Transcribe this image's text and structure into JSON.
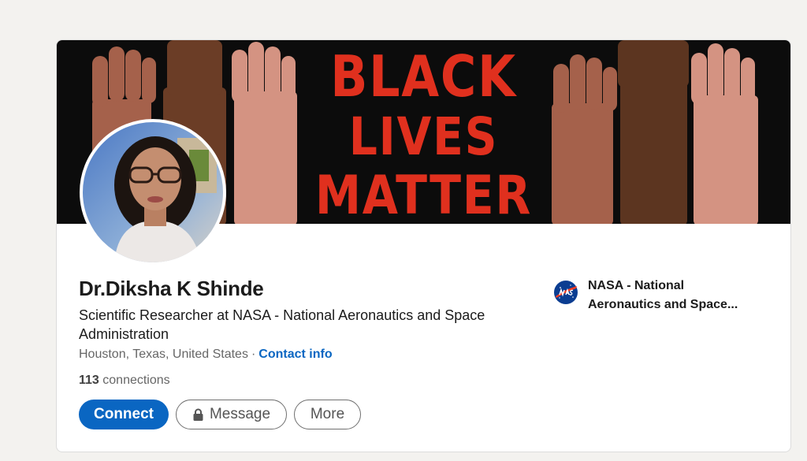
{
  "banner": {
    "line1": "BLACK",
    "line2": "LIVES",
    "line3": "MATTER"
  },
  "profile": {
    "name": "Dr.Diksha K Shinde",
    "headline": "Scientific Researcher at NASA - National Aeronautics and Space Administration",
    "location": "Houston, Texas, United States",
    "separator": "·",
    "contact_info_label": "Contact info",
    "connections_count": "113",
    "connections_label": "connections"
  },
  "actions": {
    "connect_label": "Connect",
    "message_label": "Message",
    "more_label": "More"
  },
  "company": {
    "name": "NASA - National Aeronautics and Space...",
    "logo_icon": "nasa-logo-icon"
  },
  "colors": {
    "accent": "#0a66c2",
    "banner_text": "#e0301e",
    "banner_bg": "#0c0c0c",
    "page_bg": "#f3f2ef"
  }
}
